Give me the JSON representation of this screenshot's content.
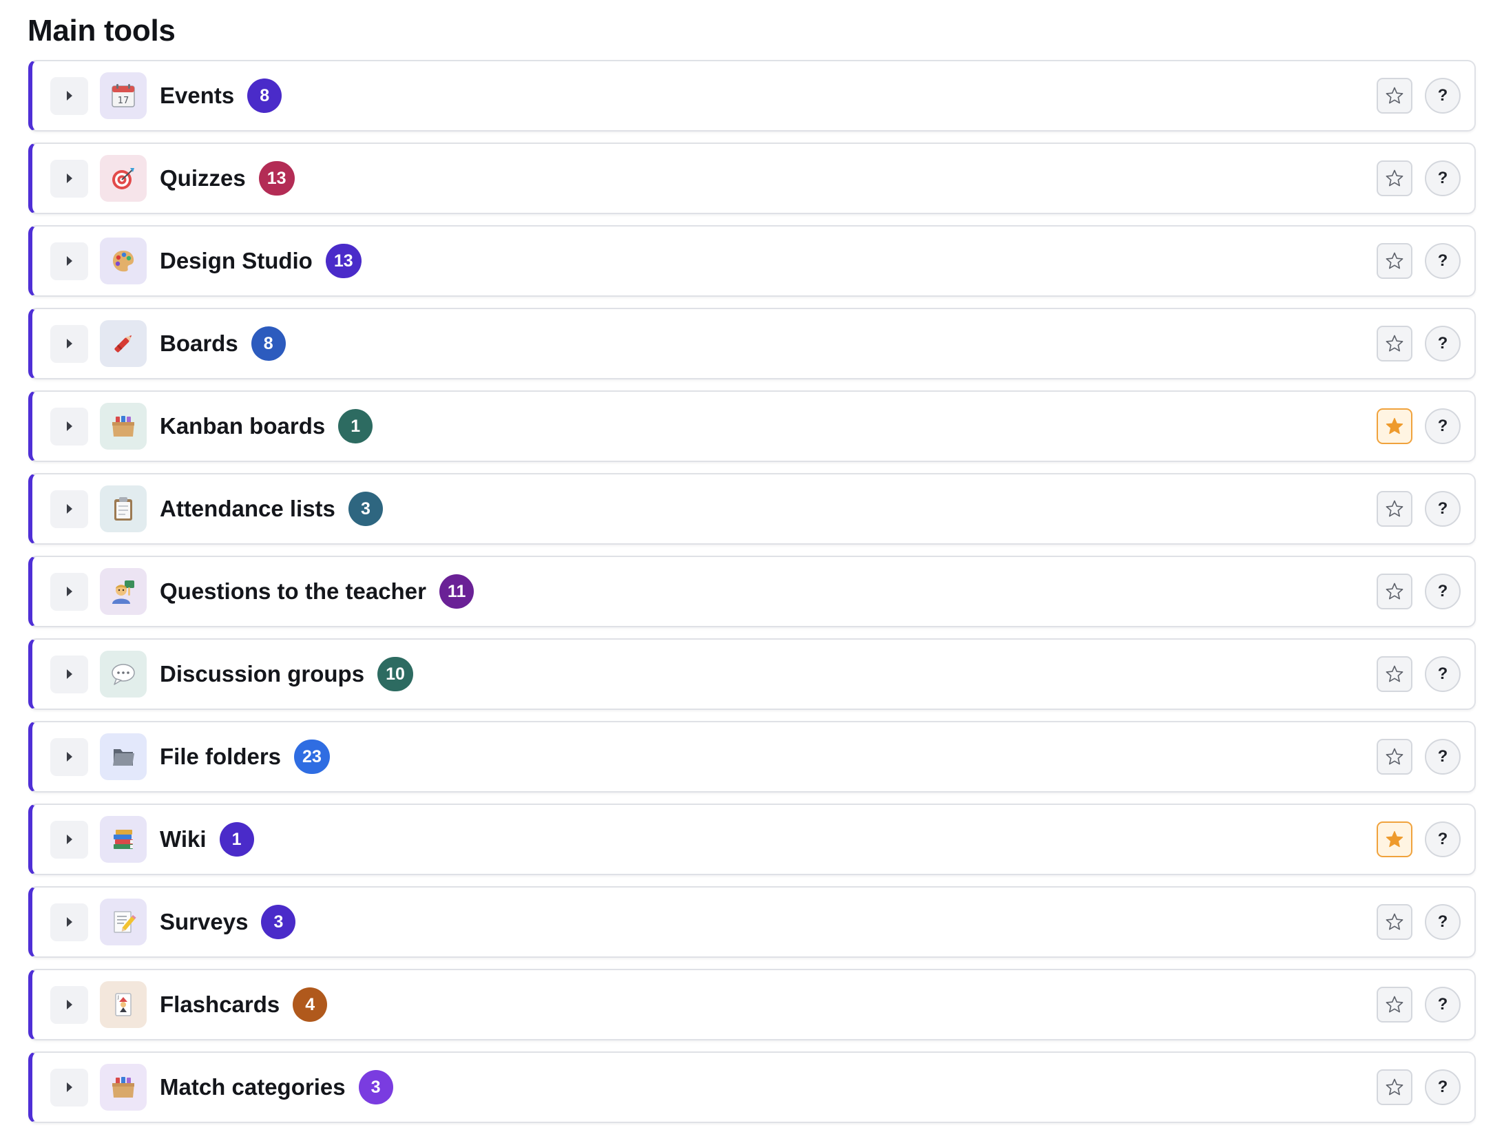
{
  "page": {
    "section_title": "Main tools"
  },
  "accent_color": "#4f2fd6",
  "tools": [
    {
      "name": "Events",
      "count": "8",
      "icon": "calendar-icon",
      "icon_bg": "#e8e5f7",
      "badge_color": "#4a2bc9",
      "favorite": false,
      "help_label": "?"
    },
    {
      "name": "Quizzes",
      "count": "13",
      "icon": "target-icon",
      "icon_bg": "#f6e4ea",
      "badge_color": "#b32c55",
      "favorite": false,
      "help_label": "?"
    },
    {
      "name": "Design Studio",
      "count": "13",
      "icon": "palette-icon",
      "icon_bg": "#e8e5f7",
      "badge_color": "#4a2bc9",
      "favorite": false,
      "help_label": "?"
    },
    {
      "name": "Boards",
      "count": "8",
      "icon": "crayon-icon",
      "icon_bg": "#e4e8f2",
      "badge_color": "#2c5bbe",
      "favorite": false,
      "help_label": "?"
    },
    {
      "name": "Kanban boards",
      "count": "1",
      "icon": "card-box-icon",
      "icon_bg": "#e2eeeb",
      "badge_color": "#2d6b61",
      "favorite": true,
      "help_label": "?"
    },
    {
      "name": "Attendance lists",
      "count": "3",
      "icon": "clipboard-icon",
      "icon_bg": "#e2ecef",
      "badge_color": "#2e6680",
      "favorite": false,
      "help_label": "?"
    },
    {
      "name": "Questions to the teacher",
      "count": "11",
      "icon": "teacher-icon",
      "icon_bg": "#ece4f3",
      "badge_color": "#6a2196",
      "favorite": false,
      "help_label": "?"
    },
    {
      "name": "Discussion groups",
      "count": "10",
      "icon": "speech-bubble-icon",
      "icon_bg": "#e2eeeb",
      "badge_color": "#2d6b61",
      "favorite": false,
      "help_label": "?"
    },
    {
      "name": "File folders",
      "count": "23",
      "icon": "folder-icon",
      "icon_bg": "#e3e8fb",
      "badge_color": "#2f6de2",
      "favorite": false,
      "help_label": "?"
    },
    {
      "name": "Wiki",
      "count": "1",
      "icon": "books-icon",
      "icon_bg": "#e8e5f7",
      "badge_color": "#4a2bc9",
      "favorite": true,
      "help_label": "?"
    },
    {
      "name": "Surveys",
      "count": "3",
      "icon": "memo-icon",
      "icon_bg": "#e8e5f7",
      "badge_color": "#4a2bc9",
      "favorite": false,
      "help_label": "?"
    },
    {
      "name": "Flashcards",
      "count": "4",
      "icon": "joker-card-icon",
      "icon_bg": "#f3e7dc",
      "badge_color": "#b0591c",
      "favorite": false,
      "help_label": "?"
    },
    {
      "name": "Match categories",
      "count": "3",
      "icon": "card-box-icon",
      "icon_bg": "#ede6f8",
      "badge_color": "#7a3ce0",
      "favorite": false,
      "help_label": "?"
    }
  ]
}
